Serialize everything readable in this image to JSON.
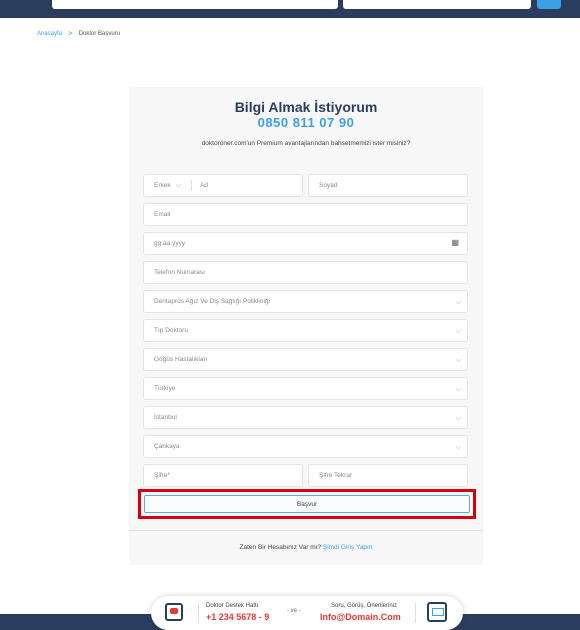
{
  "breadcrumb": {
    "home": "Anasayfa",
    "separator": ">",
    "current": "Doktor Başvuru"
  },
  "form": {
    "title": "Bilgi Almak İstiyorum",
    "phone": "0850 811 07 90",
    "description": "doktoröner.com'un Premium avantajlarından bahsetmemizi ister misiniz?",
    "gender": {
      "value": "Erkek"
    },
    "first_name": {
      "placeholder": "Ad"
    },
    "last_name": {
      "placeholder": "Soyad"
    },
    "email": {
      "placeholder": "Email"
    },
    "birthdate": {
      "placeholder": "gg.aa.yyyy"
    },
    "phone_number": {
      "placeholder": "Telefon Numarası"
    },
    "clinic": {
      "value": "Dentapros Ağız Ve Diş Sağlığı Polikliniği"
    },
    "title_select": {
      "value": "Tıp Doktoru"
    },
    "specialty": {
      "value": "Göğüs Hastalıkları"
    },
    "country": {
      "value": "Türkiye"
    },
    "city": {
      "value": "İstanbul"
    },
    "district": {
      "value": "Çankaya"
    },
    "password": {
      "placeholder": "Şifre*"
    },
    "password_repeat": {
      "placeholder": "Şifre Tekrar"
    },
    "submit_label": "Başvur",
    "login_prompt": "Zaten Bir Hesabınız Var mı?",
    "login_link": "Şimdi Giriş Yapın"
  },
  "footer": {
    "support_label": "Doktor Destek Hattı",
    "support_number": "+1 234 5678 - 9",
    "and": "- ve -",
    "feedback_label": "Soru, Görüş, Önerileriniz",
    "feedback_email": "Info@Domain.Com"
  },
  "icons": {
    "chevron": "chevron-down-icon",
    "calendar": "calendar-icon",
    "support": "support-icon",
    "mail": "mail-icon"
  },
  "colors": {
    "navy": "#2b3d5e",
    "accent": "#3ba1e5",
    "highlight": "#d9000d",
    "red": "#e53935"
  }
}
